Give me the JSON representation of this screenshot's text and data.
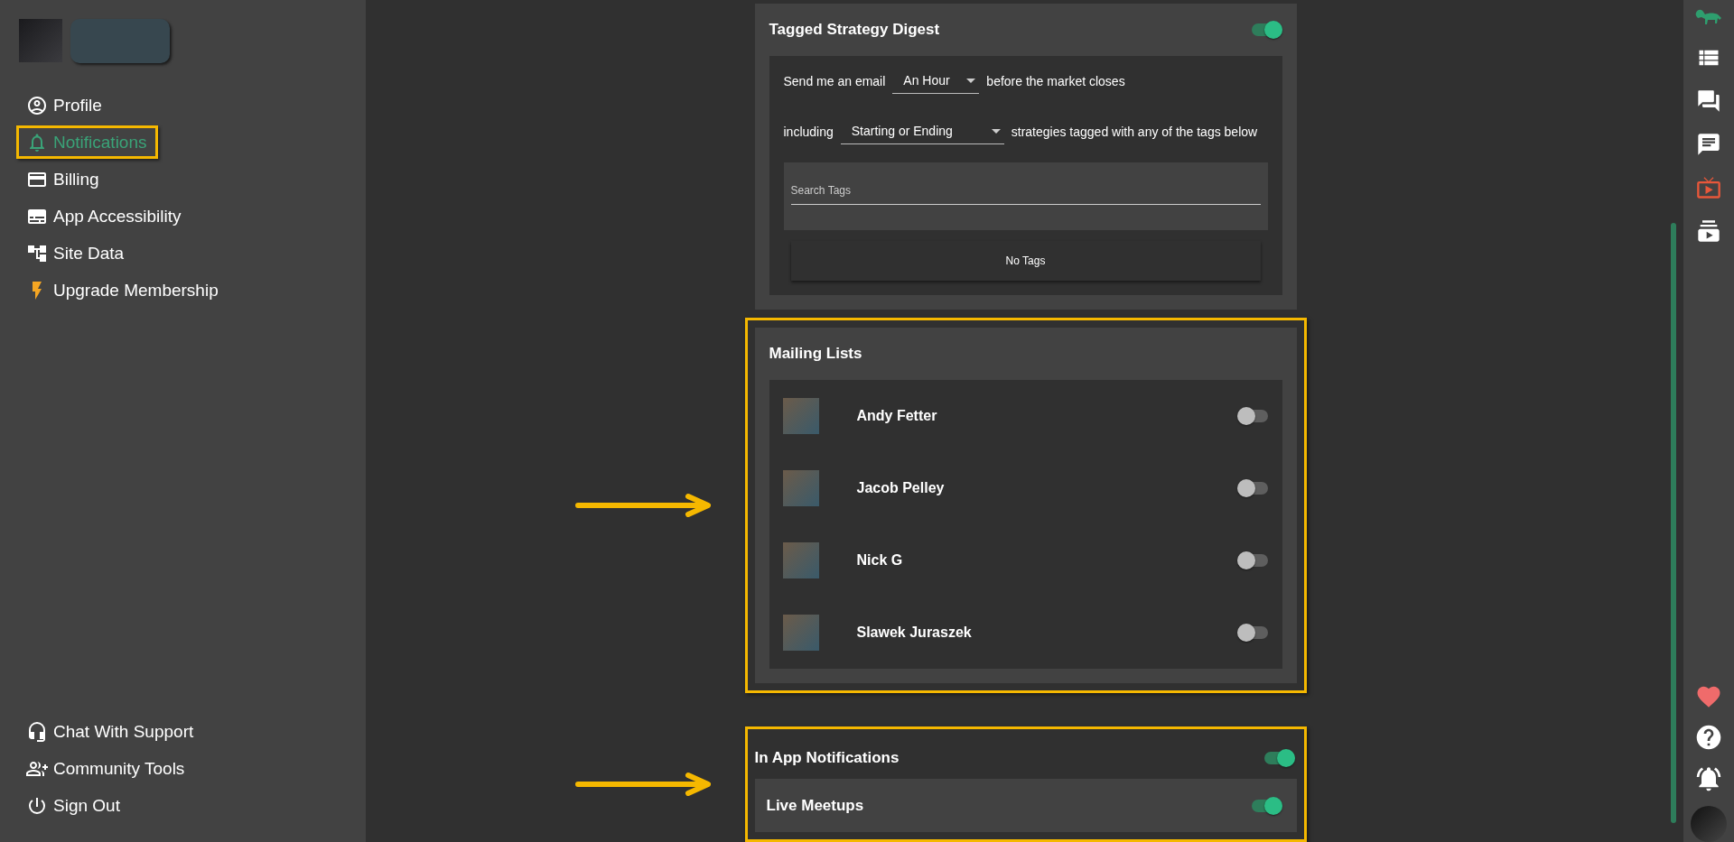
{
  "sidebar": {
    "items": [
      {
        "label": "Profile",
        "selected": false,
        "highlighted": false
      },
      {
        "label": "Notifications",
        "selected": true,
        "highlighted": true
      },
      {
        "label": "Billing",
        "selected": false,
        "highlighted": false
      },
      {
        "label": "App Accessibility",
        "selected": false,
        "highlighted": false
      },
      {
        "label": "Site Data",
        "selected": false,
        "highlighted": false
      },
      {
        "label": "Upgrade Membership",
        "selected": false,
        "highlighted": false
      }
    ],
    "footer_items": [
      {
        "label": "Chat With Support"
      },
      {
        "label": "Community Tools"
      },
      {
        "label": "Sign Out"
      }
    ]
  },
  "digest": {
    "title": "Tagged Strategy Digest",
    "on": true,
    "highlighted": false,
    "sentence_1": {
      "before": "Send me an email",
      "select": "An Hour",
      "after": "before the market closes"
    },
    "sentence_2": {
      "before": "including",
      "select": "Starting or Ending",
      "after": "strategies tagged with any of the tags below"
    },
    "search": {
      "placeholder": "Search Tags"
    },
    "empty": "No Tags"
  },
  "mailing_lists": {
    "title": "Mailing Lists",
    "highlighted": true,
    "items": [
      {
        "name": "Andy Fetter",
        "on": false
      },
      {
        "name": "Jacob Pelley",
        "on": false
      },
      {
        "name": "Nick G",
        "on": false
      },
      {
        "name": "Slawek Juraszek",
        "on": false
      }
    ]
  },
  "in_app": {
    "title": "In App Notifications",
    "on": true,
    "highlighted": true,
    "items": [
      {
        "name": "Live Meetups",
        "on": true
      }
    ]
  }
}
